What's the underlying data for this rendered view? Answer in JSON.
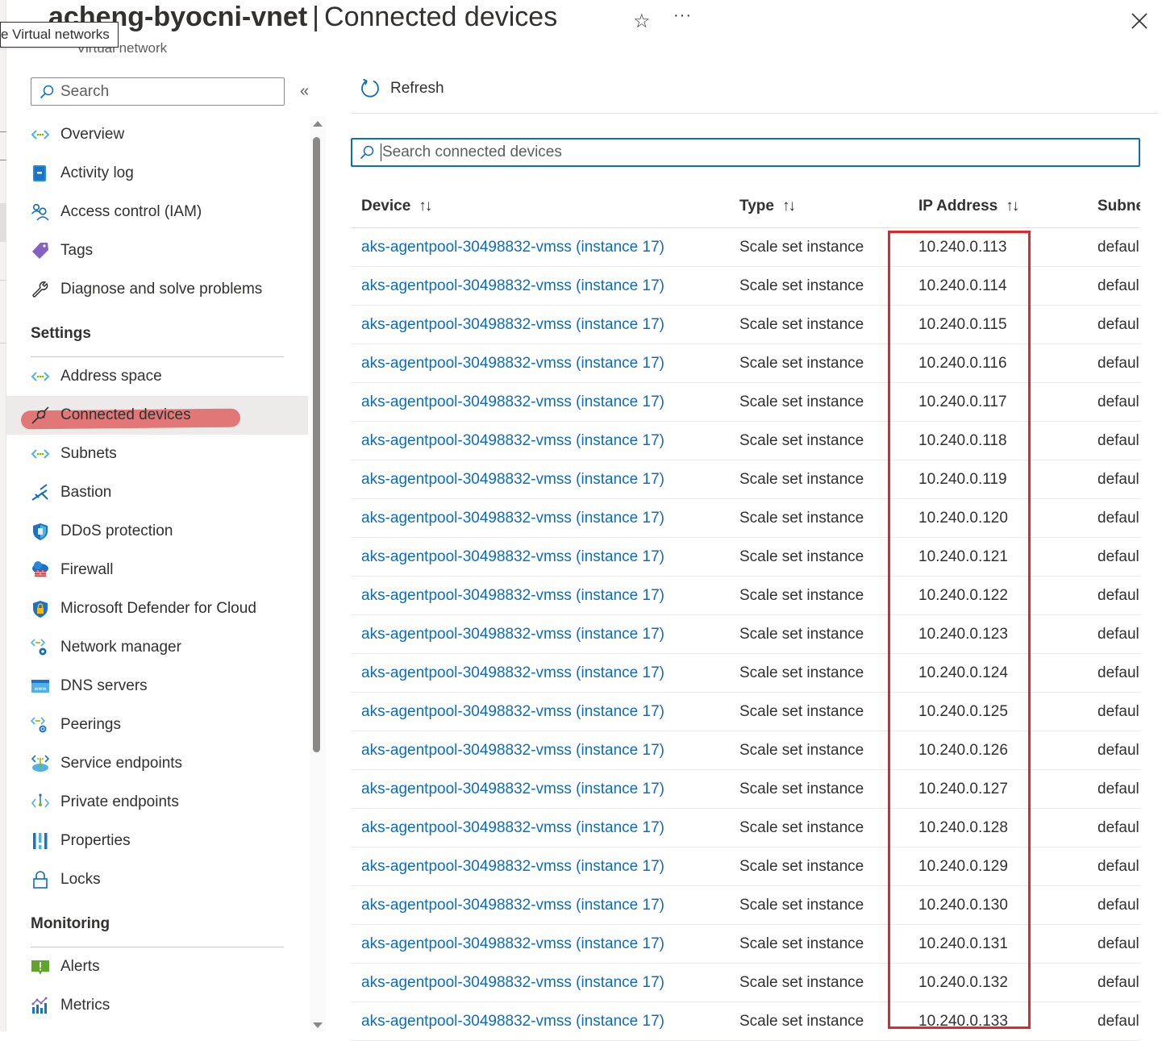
{
  "header": {
    "resource_name": "acheng-byocni-vnet",
    "page_title": "Connected devices",
    "subtitle": "Virtual network",
    "tooltip": "e Virtual networks",
    "favorite_icon": "star-icon",
    "more_icon": "ellipsis-icon",
    "close_icon": "close-icon"
  },
  "sidebar": {
    "search_placeholder": "Search",
    "collapse_icon": "double-chevron-left-icon",
    "groups": [
      {
        "heading": "",
        "items": [
          {
            "label": "Overview",
            "icon": "vnet-icon"
          },
          {
            "label": "Activity log",
            "icon": "activity-log-icon"
          },
          {
            "label": "Access control (IAM)",
            "icon": "iam-icon"
          },
          {
            "label": "Tags",
            "icon": "tag-icon"
          },
          {
            "label": "Diagnose and solve problems",
            "icon": "wrench-icon"
          }
        ]
      },
      {
        "heading": "Settings",
        "items": [
          {
            "label": "Address space",
            "icon": "vnet-icon"
          },
          {
            "label": "Connected devices",
            "icon": "plug-icon",
            "active": true
          },
          {
            "label": "Subnets",
            "icon": "vnet-icon"
          },
          {
            "label": "Bastion",
            "icon": "bastion-icon"
          },
          {
            "label": "DDoS protection",
            "icon": "ddos-shield-icon"
          },
          {
            "label": "Firewall",
            "icon": "firewall-icon"
          },
          {
            "label": "Microsoft Defender for Cloud",
            "icon": "defender-icon"
          },
          {
            "label": "Network manager",
            "icon": "network-manager-icon"
          },
          {
            "label": "DNS servers",
            "icon": "dns-icon"
          },
          {
            "label": "Peerings",
            "icon": "peerings-icon"
          },
          {
            "label": "Service endpoints",
            "icon": "service-endpoints-icon"
          },
          {
            "label": "Private endpoints",
            "icon": "private-endpoints-icon"
          },
          {
            "label": "Properties",
            "icon": "properties-icon"
          },
          {
            "label": "Locks",
            "icon": "lock-icon"
          }
        ]
      },
      {
        "heading": "Monitoring",
        "items": [
          {
            "label": "Alerts",
            "icon": "alerts-icon"
          },
          {
            "label": "Metrics",
            "icon": "metrics-icon"
          }
        ]
      }
    ]
  },
  "toolbar": {
    "refresh_label": "Refresh"
  },
  "search": {
    "placeholder": "Search connected devices",
    "value": ""
  },
  "table": {
    "columns": [
      {
        "label": "Device",
        "sortable": true
      },
      {
        "label": "Type",
        "sortable": true
      },
      {
        "label": "IP Address",
        "sortable": true
      },
      {
        "label": "Subne",
        "sortable": false
      }
    ],
    "sort_glyph": "↑↓",
    "rows": [
      {
        "device": "aks-agentpool-30498832-vmss (instance 17)",
        "type": "Scale set instance",
        "ip": "10.240.0.113",
        "subnet": "defaul"
      },
      {
        "device": "aks-agentpool-30498832-vmss (instance 17)",
        "type": "Scale set instance",
        "ip": "10.240.0.114",
        "subnet": "defaul"
      },
      {
        "device": "aks-agentpool-30498832-vmss (instance 17)",
        "type": "Scale set instance",
        "ip": "10.240.0.115",
        "subnet": "defaul"
      },
      {
        "device": "aks-agentpool-30498832-vmss (instance 17)",
        "type": "Scale set instance",
        "ip": "10.240.0.116",
        "subnet": "defaul"
      },
      {
        "device": "aks-agentpool-30498832-vmss (instance 17)",
        "type": "Scale set instance",
        "ip": "10.240.0.117",
        "subnet": "defaul"
      },
      {
        "device": "aks-agentpool-30498832-vmss (instance 17)",
        "type": "Scale set instance",
        "ip": "10.240.0.118",
        "subnet": "defaul"
      },
      {
        "device": "aks-agentpool-30498832-vmss (instance 17)",
        "type": "Scale set instance",
        "ip": "10.240.0.119",
        "subnet": "defaul"
      },
      {
        "device": "aks-agentpool-30498832-vmss (instance 17)",
        "type": "Scale set instance",
        "ip": "10.240.0.120",
        "subnet": "defaul"
      },
      {
        "device": "aks-agentpool-30498832-vmss (instance 17)",
        "type": "Scale set instance",
        "ip": "10.240.0.121",
        "subnet": "defaul"
      },
      {
        "device": "aks-agentpool-30498832-vmss (instance 17)",
        "type": "Scale set instance",
        "ip": "10.240.0.122",
        "subnet": "defaul"
      },
      {
        "device": "aks-agentpool-30498832-vmss (instance 17)",
        "type": "Scale set instance",
        "ip": "10.240.0.123",
        "subnet": "defaul"
      },
      {
        "device": "aks-agentpool-30498832-vmss (instance 17)",
        "type": "Scale set instance",
        "ip": "10.240.0.124",
        "subnet": "defaul"
      },
      {
        "device": "aks-agentpool-30498832-vmss (instance 17)",
        "type": "Scale set instance",
        "ip": "10.240.0.125",
        "subnet": "defaul"
      },
      {
        "device": "aks-agentpool-30498832-vmss (instance 17)",
        "type": "Scale set instance",
        "ip": "10.240.0.126",
        "subnet": "defaul"
      },
      {
        "device": "aks-agentpool-30498832-vmss (instance 17)",
        "type": "Scale set instance",
        "ip": "10.240.0.127",
        "subnet": "defaul"
      },
      {
        "device": "aks-agentpool-30498832-vmss (instance 17)",
        "type": "Scale set instance",
        "ip": "10.240.0.128",
        "subnet": "defaul"
      },
      {
        "device": "aks-agentpool-30498832-vmss (instance 17)",
        "type": "Scale set instance",
        "ip": "10.240.0.129",
        "subnet": "defaul"
      },
      {
        "device": "aks-agentpool-30498832-vmss (instance 17)",
        "type": "Scale set instance",
        "ip": "10.240.0.130",
        "subnet": "defaul"
      },
      {
        "device": "aks-agentpool-30498832-vmss (instance 17)",
        "type": "Scale set instance",
        "ip": "10.240.0.131",
        "subnet": "defaul"
      },
      {
        "device": "aks-agentpool-30498832-vmss (instance 17)",
        "type": "Scale set instance",
        "ip": "10.240.0.132",
        "subnet": "defaul"
      },
      {
        "device": "aks-agentpool-30498832-vmss (instance 17)",
        "type": "Scale set instance",
        "ip": "10.240.0.133",
        "subnet": "defaul"
      }
    ]
  },
  "annotations": {
    "ip_column_highlight_color": "#e3262a",
    "sidebar_highlight_color": "#dc5050"
  },
  "colors": {
    "link": "#0f6cbd",
    "text": "#323130",
    "active_nav_bg": "#edebe9"
  }
}
